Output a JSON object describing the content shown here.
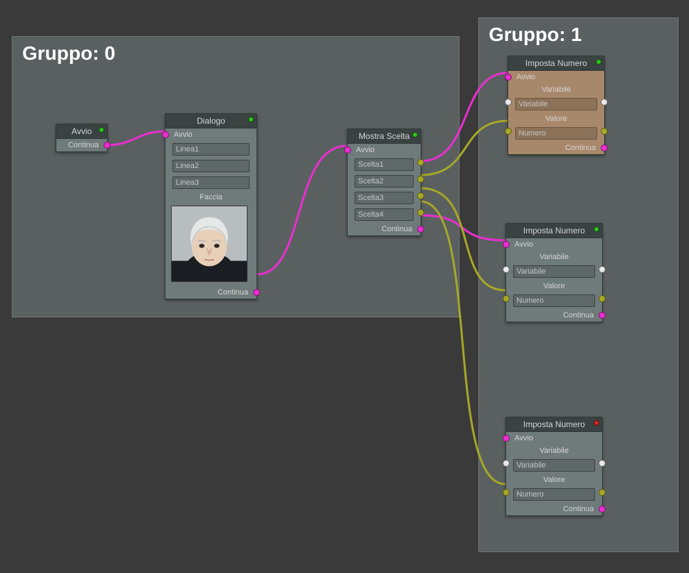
{
  "groups": [
    {
      "id": 0,
      "title": "Gruppo: 0"
    },
    {
      "id": 1,
      "title": "Gruppo: 1"
    }
  ],
  "nodes": {
    "avvio": {
      "title": "Avvio",
      "continua": "Continua"
    },
    "dialogo": {
      "title": "Dialogo",
      "avvio": "Avvio",
      "linea1": "Linea1",
      "linea2": "Linea2",
      "linea3": "Linea3",
      "faccia": "Faccia",
      "continua": "Continua"
    },
    "mostra_scelta": {
      "title": "Mostra Scelta",
      "avvio": "Avvio",
      "scelta1": "Scelta1",
      "scelta2": "Scelta2",
      "scelta3": "Scelta3",
      "scelta4": "Scelta4",
      "continua": "Continua"
    },
    "imposta_numero": {
      "title": "Imposta Numero",
      "avvio": "Avvio",
      "variabile_label": "Variabile",
      "variabile_field": "Variabile",
      "valore_label": "Valore",
      "numero_field": "Numero",
      "continua": "Continua"
    }
  },
  "colors": {
    "flow_link": "#e82fd0",
    "data_link": "#a6a828",
    "status_green": "#2ec41e",
    "status_red": "#d82b2b"
  }
}
